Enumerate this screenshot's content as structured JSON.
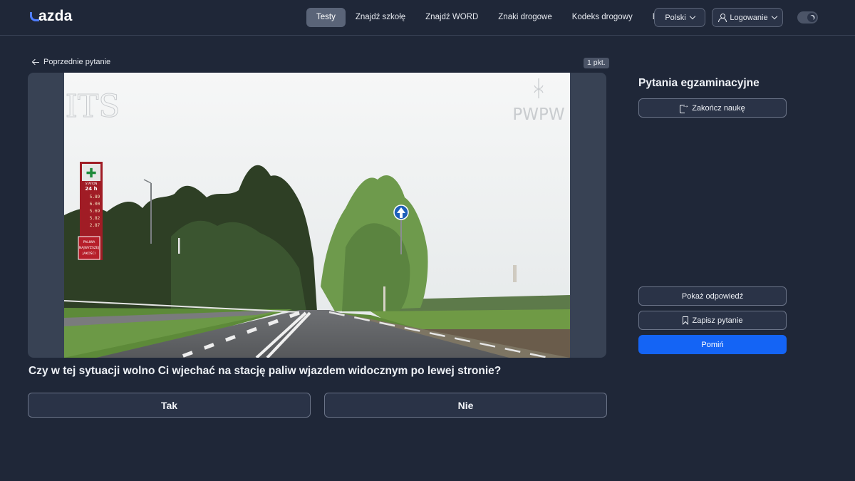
{
  "header": {
    "logo_text": "azda",
    "nav": [
      {
        "label": "Testy",
        "active": true
      },
      {
        "label": "Znajdź szkołę",
        "active": false
      },
      {
        "label": "Znajdź WORD",
        "active": false
      },
      {
        "label": "Znaki drogowe",
        "active": false
      },
      {
        "label": "Kodeks drogowy",
        "active": false
      },
      {
        "label": "Blog",
        "active": false
      }
    ],
    "language_label": "Polski",
    "login_label": "Logowanie",
    "theme": "dark"
  },
  "question_view": {
    "back_label": "Poprzednie pytanie",
    "points_label": "1 pkt.",
    "image_watermarks": [
      "ITS",
      "PWPW"
    ],
    "fuel_sign": {
      "top": "STATION",
      "price_header": "24 h",
      "prices": [
        "5.89",
        "6.00",
        "5.69",
        "5.82",
        "2.87"
      ],
      "banner_lines": [
        "PALIWA",
        "NAJWYŻSZEJ",
        "JAKOŚCI"
      ]
    },
    "question_text": "Czy w tej sytuacji wolno Ci wjechać na stację paliw wjazdem widocznym po lewej stronie?",
    "answers": [
      "Tak",
      "Nie"
    ]
  },
  "sidebar": {
    "title": "Pytania egzaminacyjne",
    "end_label": "Zakończ naukę",
    "show_answer_label": "Pokaż odpowiedź",
    "save_label": "Zapisz pytanie",
    "skip_label": "Pomiń"
  },
  "colors": {
    "background": "#1f2738",
    "primary": "#1464f5",
    "accent_logo": "#4f7dff"
  }
}
